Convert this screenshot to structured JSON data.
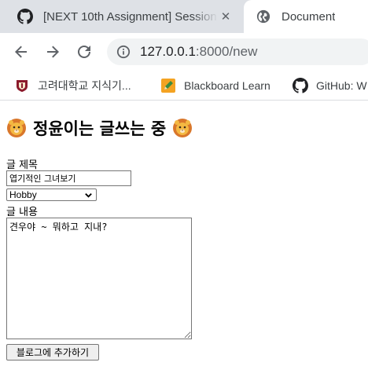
{
  "browser": {
    "tabs": [
      {
        "title": "[NEXT 10th Assignment] Session",
        "favicon": "github-icon",
        "active": false
      },
      {
        "title": "Document",
        "favicon": "globe-icon",
        "active": true
      }
    ],
    "address": {
      "host": "127.0.0.1",
      "rest": ":8000/new"
    },
    "bookmarks": [
      {
        "label": "고려대학교 지식기...",
        "icon": "korea-university-icon"
      },
      {
        "label": "Blackboard Learn",
        "icon": "pencil-icon"
      },
      {
        "label": "GitHub: W",
        "icon": "github-icon"
      }
    ]
  },
  "page": {
    "heading": "정윤이는 글쓰는 중",
    "title_label": "글 제목",
    "title_value": "엽기적인 그녀보기",
    "category_value": "Hobby",
    "content_label": "글 내용",
    "content_value": "견우야 ~ 뭐하고 지내?",
    "submit_label": "블로그에 추가하기"
  },
  "colors": {
    "tabstrip": "#dee1e6",
    "omnibox": "#f1f3f4",
    "lion": "#f4a322"
  }
}
